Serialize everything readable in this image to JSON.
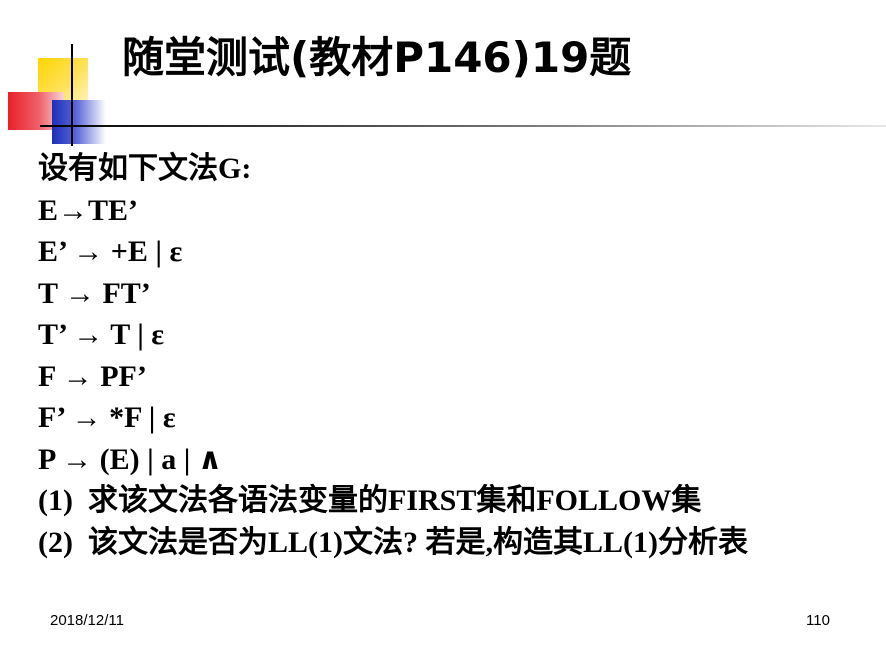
{
  "title": "随堂测试(教材P146)19题",
  "intro": "设有如下文法G:",
  "productions": [
    "E→TE’",
    "E’ → +E | ε",
    "T → FT’",
    "T’ → T | ε",
    "F → PF’",
    "F’ → *F | ε",
    "P → (E) | a | ∧"
  ],
  "questions": [
    {
      "num": "(1)",
      "text": "求该文法各语法变量的FIRST集和FOLLOW集"
    },
    {
      "num": "(2)",
      "text": "该文法是否为LL(1)文法? 若是,构造其LL(1)分析表"
    }
  ],
  "footer": {
    "date": "2018/12/11",
    "page": "110"
  },
  "colors": {
    "yellow": "#ffd400",
    "red": "#e8202a",
    "blue": "#1c2fb8"
  }
}
